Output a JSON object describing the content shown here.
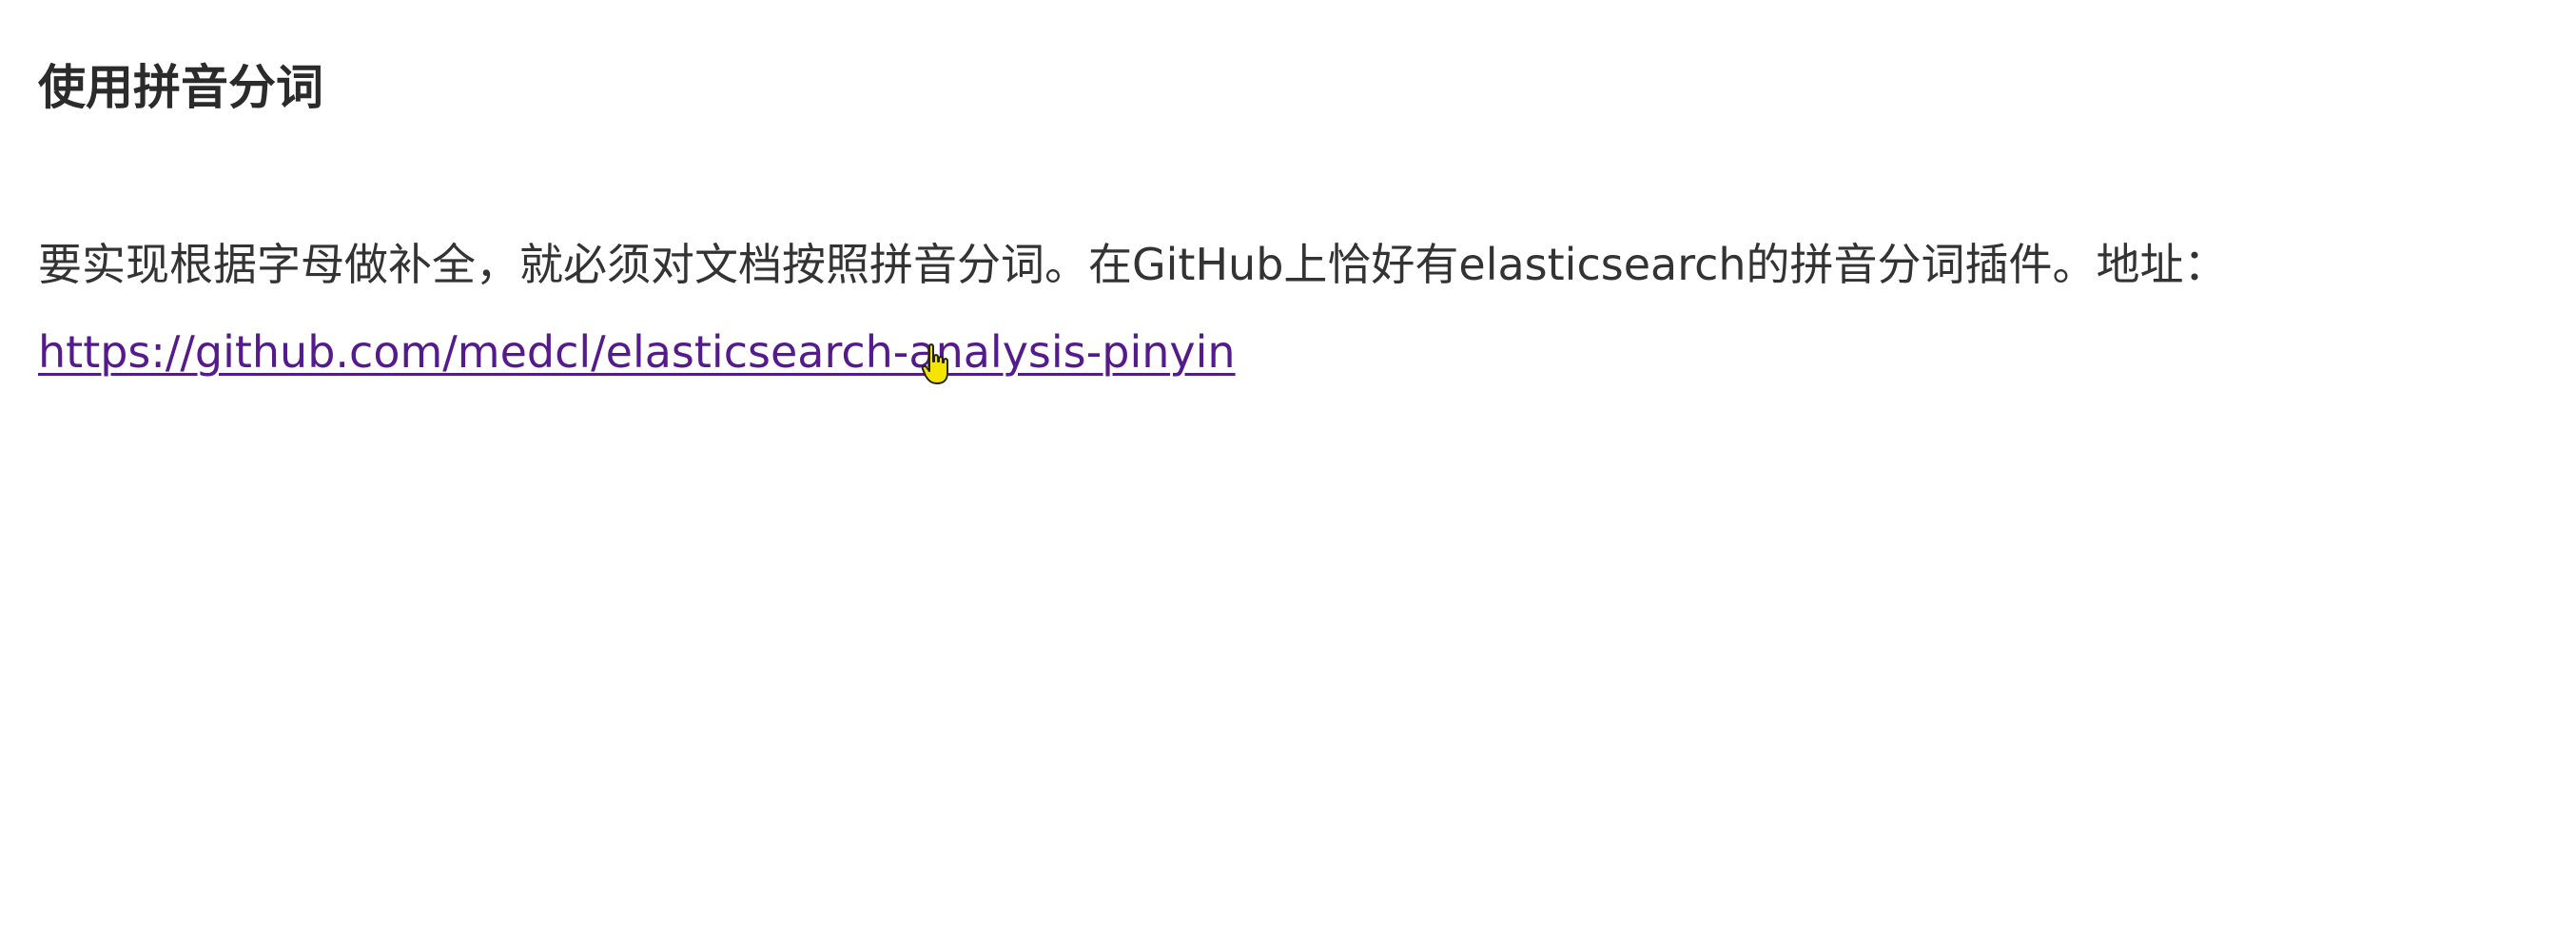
{
  "section": {
    "heading": "使用拼音分词",
    "paragraph_text": "要实现根据字母做补全，就必须对文档按照拼音分词。在GitHub上恰好有elasticsearch的拼音分词插件。地址：",
    "link_text": "https://github.com/medcl/elasticsearch-analysis-pinyin"
  },
  "colors": {
    "text": "#333333",
    "heading": "#2b2b2b",
    "link_visited": "#551a8b",
    "cursor_fill": "#f5e400"
  },
  "icons": {
    "cursor": "hand-pointer-icon"
  }
}
